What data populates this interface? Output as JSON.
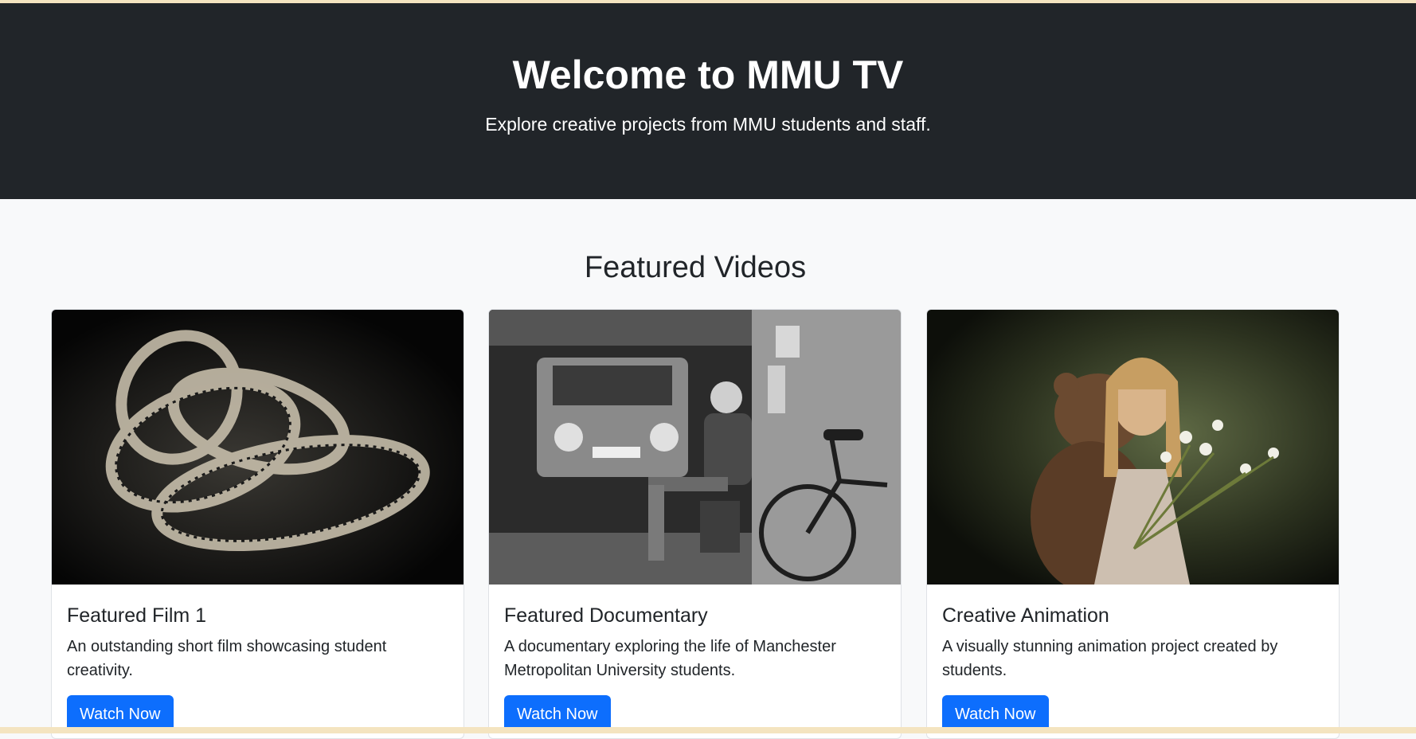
{
  "hero": {
    "title": "Welcome to MMU TV",
    "subtitle": "Explore creative projects from MMU students and staff."
  },
  "featured": {
    "title": "Featured Videos",
    "cards": [
      {
        "title": "Featured Film 1",
        "description": "An outstanding short film showcasing student creativity.",
        "button": "Watch Now",
        "image": "film-reel-image"
      },
      {
        "title": "Featured Documentary",
        "description": "A documentary exploring the life of Manchester Metropolitan University students.",
        "button": "Watch Now",
        "image": "man-with-bicycle-image"
      },
      {
        "title": "Creative Animation",
        "description": "A visually stunning animation project created by students.",
        "button": "Watch Now",
        "image": "girl-with-bear-image"
      }
    ]
  },
  "colors": {
    "hero_background": "#212529",
    "page_background": "#f8f9fa",
    "button_primary": "#0d6efd"
  }
}
